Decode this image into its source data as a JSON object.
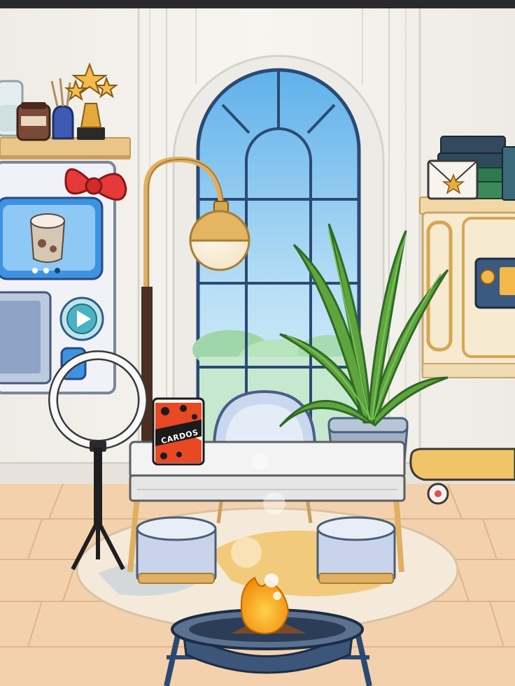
{
  "scene": {
    "card_box": {
      "label": "CARDOS",
      "icon": "card-box-icon"
    },
    "ice_cream_machine": {
      "screen_item": "milkshake-cup-icon",
      "carousel_dots": 3,
      "active_dot": 2
    },
    "colors": {
      "wall": "#f3f1ec",
      "floor": "#f4d1ad",
      "window_sky": "#a8d4f0",
      "plant": "#5a9a3a",
      "gold": "#e2b567",
      "rug": "#f5ead9",
      "stool": "#c9d4ea",
      "fire": "#f3a516"
    }
  }
}
